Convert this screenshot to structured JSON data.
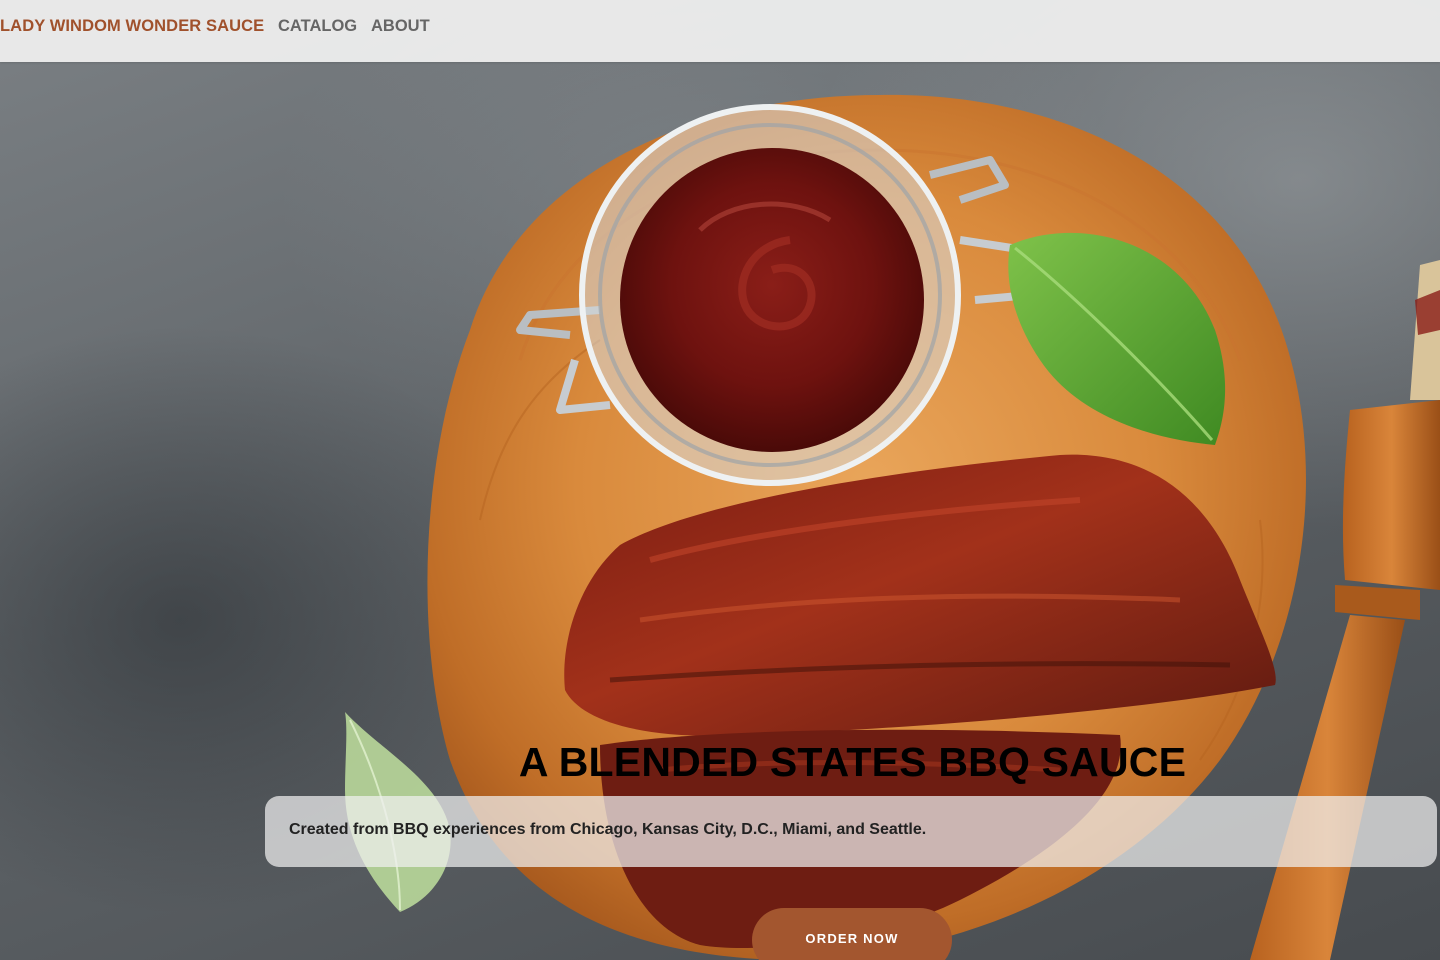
{
  "nav": {
    "brand": "LADY WINDOM WONDER SAUCE",
    "links": [
      {
        "label": "CATALOG"
      },
      {
        "label": "ABOUT"
      }
    ]
  },
  "hero": {
    "image_description_icon": "bbq-ribs-sauce-photo",
    "title": "A BLENDED STATES BBQ SAUCE",
    "tagline": "Created from BBQ experiences from Chicago, Kansas City, D.C., Miami, and Seattle.",
    "cta_label": "ORDER NOW"
  },
  "colors": {
    "brand": "#a0512c",
    "nav_text": "#666666",
    "cta_background": "#a3562f",
    "topbar_background": "#ececec"
  }
}
